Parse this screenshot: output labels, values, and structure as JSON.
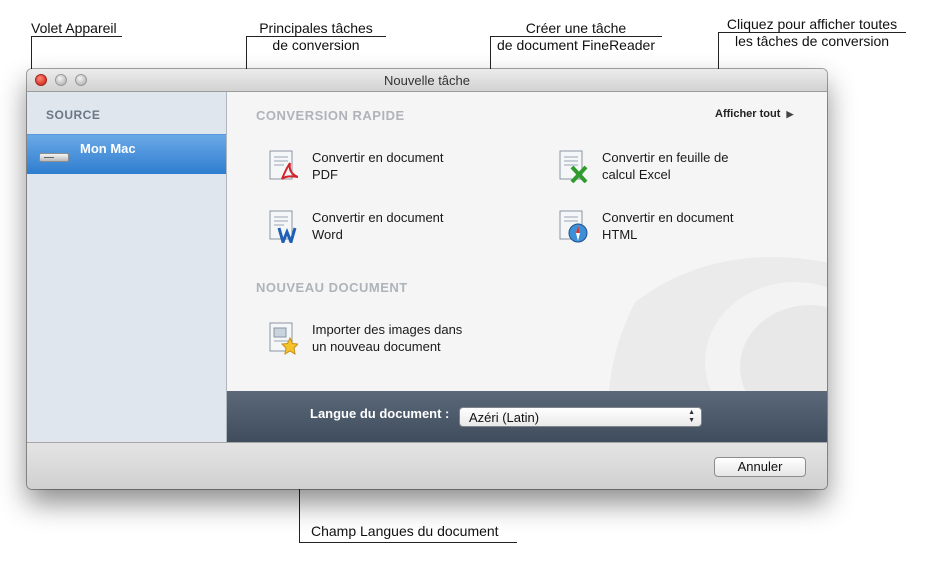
{
  "window": {
    "title": "Nouvelle tâche"
  },
  "sidebar": {
    "header": "SOURCE",
    "items": [
      {
        "label": "Mon Mac",
        "icon": "mac-mini-icon"
      }
    ]
  },
  "main": {
    "quick_conversion": {
      "header": "CONVERSION RAPIDE",
      "show_all": "Afficher tout",
      "tasks": [
        {
          "line1": "Convertir en document",
          "line2": "PDF",
          "icon": "pdf-document-icon"
        },
        {
          "line1": "Convertir en feuille de",
          "line2": "calcul Excel",
          "icon": "excel-spreadsheet-icon"
        },
        {
          "line1": "Convertir en document",
          "line2": "Word",
          "icon": "word-document-icon"
        },
        {
          "line1": "Convertir en document",
          "line2": "HTML",
          "icon": "html-document-icon"
        }
      ]
    },
    "new_document": {
      "header": "NOUVEAU DOCUMENT",
      "tasks": [
        {
          "line1": "Importer des images dans",
          "line2": "un nouveau document",
          "icon": "import-images-icon"
        }
      ]
    }
  },
  "language": {
    "label": "Langue du document :",
    "selected": "Azéri (Latin)"
  },
  "footer": {
    "cancel_label": "Annuler"
  },
  "callouts": {
    "device_pane": "Volet Appareil",
    "main_tasks_line1": "Principales tâches",
    "main_tasks_line2": "de conversion",
    "create_task_line1": "Créer une tâche",
    "create_task_line2": "de document FineReader",
    "show_all_line1": "Cliquez pour afficher toutes",
    "show_all_line2": "les tâches de conversion",
    "language_field": "Champ Langues du document"
  },
  "colors": {
    "selection": "#3c86d6",
    "sidebar": "#dfe6ee",
    "langbar": "#4c5a6a"
  }
}
